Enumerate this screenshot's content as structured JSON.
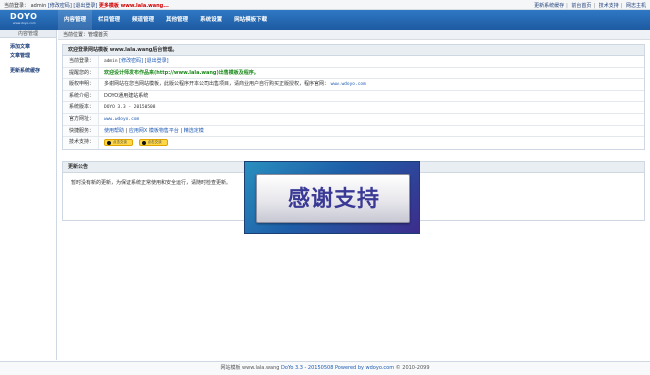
{
  "topbar": {
    "current_user_label": "当前登录：",
    "user": "admin",
    "modify_pwd": "[修改密码]",
    "logout": "[退出登录]",
    "more_templates": "更多模板 www.lala.wang...",
    "links": [
      "更新系统缓存",
      "前台首页",
      "技术支持",
      "网志主机"
    ]
  },
  "logo": {
    "title": "DOYO",
    "subtitle": "www.doyo.com"
  },
  "nav": [
    "内容管理",
    "栏目管理",
    "频道管理",
    "其他管理",
    "系统设置",
    "网站模板下载"
  ],
  "sidebar": {
    "title": "内容管理",
    "items": [
      "添加文章",
      "文章管理",
      "更新系统缓存"
    ]
  },
  "breadcrumb": "当前位置：管理首页",
  "welcome": {
    "title": "欢迎登录网站模板 www.lala.wang后台管理。",
    "rows": [
      {
        "label": "当前登录：",
        "value": "admin",
        "extra1": "[修改密码]",
        "extra2": "[退出登录]"
      },
      {
        "label": "提醒您的：",
        "value": "欢迎设计师发布作品来(http://www.lala.wang)出售模板及程序。"
      },
      {
        "label": "版权申明：",
        "value": "多谢网站在您当网站模板，此版公程序开本公司出售项目，请商业用户自行购买正版授权，程序官网：",
        "link": "www.wdoyo.com"
      },
      {
        "label": "系统介绍：",
        "value": "DOYO通用建站系统"
      },
      {
        "label": "系统版本：",
        "value": "DOYO 3.3 - 20150508"
      },
      {
        "label": "官方网址：",
        "value": "www.wdoyo.com"
      },
      {
        "label": "快捷服务：",
        "value": "使用帮助",
        "extra1": "应用网X 模板物售平台",
        "extra2": "精选定模"
      },
      {
        "label": "技术支持：",
        "qq1": "点击交谈",
        "qq2": "点击交谈"
      }
    ]
  },
  "announce": {
    "title": "更新公告",
    "body": "暂时没有新的更新，为保证系统正常使用和安全运行，请随时检查更新。"
  },
  "overlay": {
    "text": "感谢支持"
  },
  "footer": {
    "text1": "网站模板 www.lala.wang",
    "text2": "DoYo 3.3 - 20150508 Powered by",
    "link": "wdoyo.com",
    "text3": "© 2010-2099"
  }
}
